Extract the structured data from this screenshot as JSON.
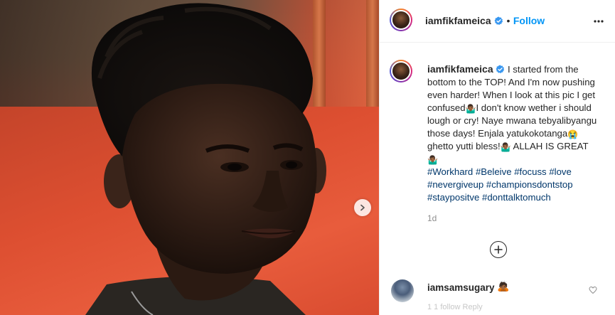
{
  "post": {
    "author": "iamfikfameica",
    "follow_label": "Follow",
    "separator": "•",
    "caption_segments": [
      {
        "type": "text",
        "value": "I started from the bottom to the TOP! And I'm now pushing even harder! When I look at this pic I get confused"
      },
      {
        "type": "emoji",
        "value": "🤷🏾‍♂️"
      },
      {
        "type": "text",
        "value": "I don't know wether i should lough or cry! Naye mwana tebyalibyangu those days! Enjala yatukokotanga"
      },
      {
        "type": "emoji",
        "value": "😭"
      },
      {
        "type": "text",
        "value": " ghetto yutti bless!"
      },
      {
        "type": "emoji",
        "value": "🤷🏾‍♂️"
      },
      {
        "type": "text",
        "value": " ALLAH IS GREAT"
      },
      {
        "type": "emoji",
        "value": "🤷🏾‍♂️"
      }
    ],
    "hashtags": [
      "#Workhard",
      "#Beleive",
      "#focuss",
      "#love",
      "#nevergiveup",
      "#championsdontstop",
      "#staypositve",
      "#donttalktomuch"
    ],
    "time": "1d"
  },
  "comment": {
    "user": "iamsamsugary",
    "emoji": "🙇🏾",
    "faded_line": "1 1 follow   Reply"
  },
  "icons": {
    "more": "more-horizontal-icon",
    "verified": "verified-badge-icon",
    "next": "chevron-right-icon",
    "load_more": "plus-circle-icon",
    "like": "heart-icon"
  },
  "colors": {
    "accent": "#0095f6",
    "hashtag": "#00376b",
    "muted": "#8e8e8e"
  }
}
